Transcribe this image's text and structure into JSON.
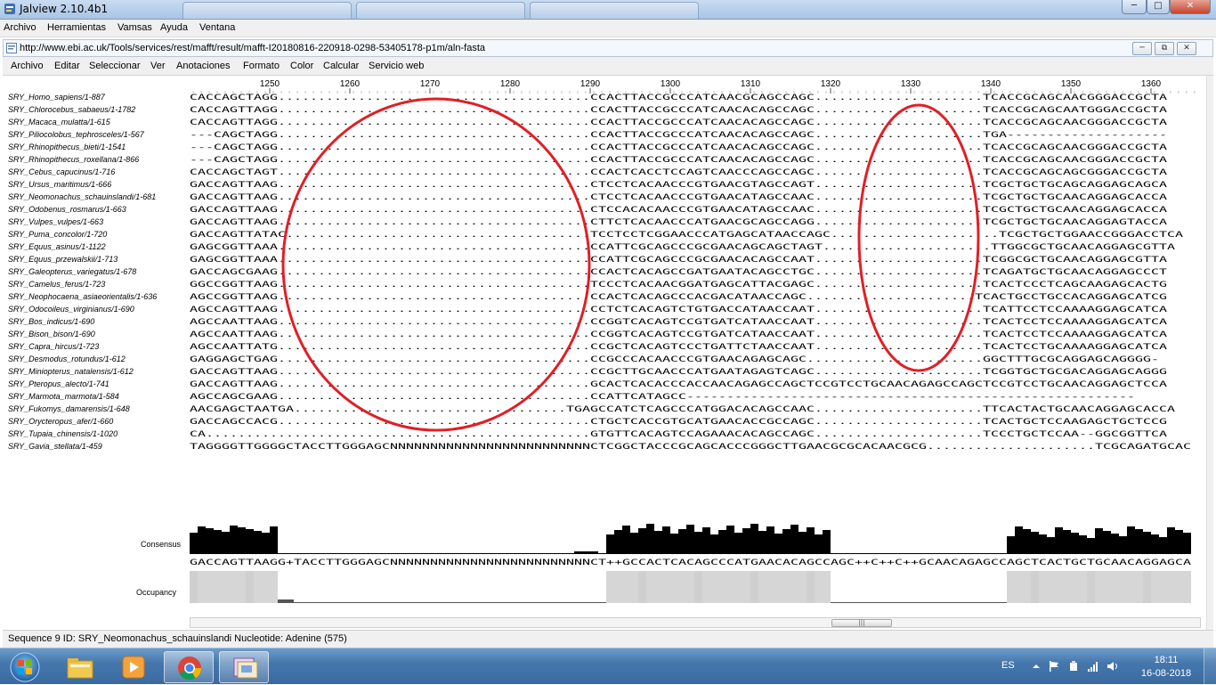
{
  "outer_window": {
    "title": "Jalview 2.10.4b1",
    "controls": {
      "minimize": "─",
      "maximize": "□",
      "close": "✕"
    }
  },
  "main_menu": [
    "Archivo",
    "Herramientas",
    "Vamsas",
    "Ayuda",
    "Ventana"
  ],
  "inner_window": {
    "title": "http://www.ebi.ac.uk/Tools/services/rest/mafft/result/mafft-I20180816-220918-0298-53405178-p1m/aln-fasta",
    "controls": {
      "minimize": "─",
      "maximize": "⧉",
      "close": "✕"
    }
  },
  "inner_menu": [
    "Archivo",
    "Editar",
    "Seleccionar",
    "Ver",
    "Anotaciones",
    "Formato",
    "Color",
    "Calcular",
    "Servicio web"
  ],
  "ruler_ticks": [
    "1250",
    "1260",
    "1270",
    "1280",
    "1290",
    "1300",
    "1310",
    "1320",
    "1330",
    "1340",
    "1350",
    "1360"
  ],
  "sequences": [
    {
      "name": "SRY_Homo_sapiens/1-887",
      "seq": "CACCAGCTAGG.......................................CCACTTACCGCCCATCAACGCAGCCAGC.....................TCACCGCAGCAACGGGACCGCTA"
    },
    {
      "name": "SRY_Chlorocebus_sabaeus/1-1782",
      "seq": "CACCAGTTAGG.......................................CCACTTACCGCCCATCAACACAGCCAGC.....................TCACCGCAGCAATGGGACCGCTA"
    },
    {
      "name": "SRY_Macaca_mulatta/1-615",
      "seq": "CACCAGTTAGG.......................................CCACTTACCGCCCATCAACACAGCCAGC.....................TCACCGCAGCAACGGGACCGCTA"
    },
    {
      "name": "SRY_Piliocolobus_tephrosceles/1-567",
      "seq": "---CAGCTAGG.......................................CCACTTACCGCCCATCAACACAGCCAGC.....................TGA--------------------"
    },
    {
      "name": "SRY_Rhinopithecus_bieti/1-1541",
      "seq": "---CAGCTAGG.......................................CCACTTACCGCCCATCAACACAGCCAGC.....................TCACCGCAGCAACGGGACCGCTA"
    },
    {
      "name": "SRY_Rhinopithecus_roxellana/1-866",
      "seq": "---CAGCTAGG.......................................CCACTTACCGCCCATCAACACAGCCAGC.....................TCACCGCAGCAACGGGACCGCTA"
    },
    {
      "name": "SRY_Cebus_capucinus/1-716",
      "seq": "CACCAGCTAGT.......................................CCACTCACCTCCAGTCAACCCAGCCAGC.....................TCACCGCAGCAGCGGGACCGCTA"
    },
    {
      "name": "SRY_Ursus_maritimus/1-666",
      "seq": "GACCAGTTAAG.......................................CTCCTCACAACCCGTGAACGTAGCCAGT.....................TCGCTGCTGCAGCAGGAGCAGCA"
    },
    {
      "name": "SRY_Neomonachus_schauinslandi/1-681",
      "seq": "GACCAGTTAAG.......................................CTCCTCACAACCCGTGAACATAGCCAAC.....................TCGCTGCTGCAACAGGAGCACCA"
    },
    {
      "name": "SRY_Odobenus_rosmarus/1-663",
      "seq": "GACCAGTTAAG.......................................CTCCACACAACCCGTGAACATAGCCAAC.....................TCGCTGCTGCAACAGGAGCACCA"
    },
    {
      "name": "SRY_Vulpes_vulpes/1-663",
      "seq": "GACCAGTTAAG.......................................CTTCTCACAACCCATGAACGCAGCCAGG.....................TCGCTGCTGCAACAGGAGTACCA"
    },
    {
      "name": "SRY_Puma_concolor/1-720",
      "seq": "GACCAGTTATAC......................................TCCTCCTCGGAACCCATGAGCATAACCAGC.....................TCGCTGCTGGAACCGGGACCTCA"
    },
    {
      "name": "SRY_Equus_asinus/1-1122",
      "seq": "GAGCGGTTAAA.......................................CCATTCGCAGCCCGCGAACAGCAGCTAGT.....................TTGGCGCTGCAACAGGAGCGTTA"
    },
    {
      "name": "SRY_Equus_przewalskii/1-713",
      "seq": "GAGCGGTTAAA.......................................CCATTCGCAGCCCGCGAACACAGCCAAT.....................TCGGCGCTGCAACAGGAGCGTTA"
    },
    {
      "name": "SRY_Galeopterus_variegatus/1-678",
      "seq": "GACCAGCGAAG.......................................CCACTCACAGCCGATGAATACAGCCTGC.....................TCAGATGCTGCAACAGGAGCCCT"
    },
    {
      "name": "SRY_Camelus_ferus/1-723",
      "seq": "GGCCGGTTAAG.......................................TCCCTCACAACGGATGAGCATTACGAGC.....................TCACTCCCTCAGCAAGAGCACTG"
    },
    {
      "name": "SRY_Neophocaena_asiaeorientalis/1-636",
      "seq": "AGCCGGTTAAG.......................................CCACTCACAGCCCACGACATAACCAGC.....................TCACTGCCTGCCACAGGAGCATCG"
    },
    {
      "name": "SRY_Odocoileus_virginianus/1-690",
      "seq": "AGCCAGTTAAG.......................................CCTCTCACAGTCTGTGACCATAACCAAT.....................TCATTCCTCCAAAAGGAGCATCA"
    },
    {
      "name": "SRY_Bos_indicus/1-690",
      "seq": "AGCCAATTAAG.......................................CCGGTCACAGTCCGTGATCATAACCAAT.....................TCACTCCTCCAAAAGGAGCATCA"
    },
    {
      "name": "SRY_Bison_bison/1-690",
      "seq": "AGCCAATTAAG.......................................CCGGTCACAGTCCGTGATCATAACCAAT.....................TCACTCCTCCAAAAGGAGCATCA"
    },
    {
      "name": "SRY_Capra_hircus/1-723",
      "seq": "AGCCAATTATG.......................................CCGCTCACAGTCCCTGATTCTAACCAAT.....................TCACTCCTGCAAAAGGAGCATCA"
    },
    {
      "name": "SRY_Desmodus_rotundus/1-612",
      "seq": "GAGGAGCTGAG.......................................CCGCCCACAACCCGTGAACAGAGCAGC......................GGCTTTGCGCAGGAGCAGGGG-"
    },
    {
      "name": "SRY_Miniopterus_natalensis/1-612",
      "seq": "GACCAGTTAAG.......................................CCGCTTGCAACCCATGAATAGAGTCAGC.....................TCGGTGCTGCGACAGGAGCAGGG"
    },
    {
      "name": "SRY_Pteropus_alecto/1-741",
      "seq": "GACCAGTTAAG.......................................GCACTCACACCCACCAACAGAGCCAGCTCCGTCCTGCAACAGAGCCAGCTCCGTCCTGCAACAGGAGCTCCA"
    },
    {
      "name": "SRY_Marmota_marmota/1-584",
      "seq": "AGCCAGCGAAG.......................................CCATTCATAGCC--------------------------------------------------------"
    },
    {
      "name": "SRY_Fukomys_damarensis/1-648",
      "seq": "AACGAGCTAATGA..................................TGAGCCATCTCAGCCCATGGACACAGCCAAC.....................TTCACTACTGCAACAGGAGCACCA"
    },
    {
      "name": "SRY_Orycteropus_afer/1-660",
      "seq": "GACCAGCCACG.......................................CTGCTCACCGTGCATGAACACCGCCAGC.....................TCACTGCTCCAAGAGCTGCTCCG"
    },
    {
      "name": "SRY_Tupaia_chinensis/1-1020",
      "seq": "CA................................................GTGTTCACAGTCCAGAAACACAGCCAGC.....................TCCCTGCTCCAA--GGCGGTTCA"
    },
    {
      "name": "SRY_Gavia_stellata/1-459",
      "seq": "TAGGGGTTGGGGCTACCTTGGGAGCNNNNNNNNNNNNNNNNNNNNNNNNNCTCGGCTACCCGCAGCACCCGGGCTTGAACGCGCACAACGCG.....................TCGCAGATGCACCCATGCACCG"
    }
  ],
  "annotations": {
    "consensus_label": "Consensus",
    "occupancy_label": "Occupancy",
    "consensus_seq": "GACCAGTTAAGG+TACCTTGGGAGCNNNNNNNNNNNNNNNNNNNNNNNNNCT++GCCACTCACAGCCCATGAACACAGCCAGC++C++C++GCAACAGAGCCAGCTCACTGCTGCAACAGGAGCACCA"
  },
  "status_bar": "Sequence 9 ID: SRY_Neomonachus_schauinslandi Nucleotide: Adenine (575)",
  "colors": {
    "highlight_circle": "#e01f26",
    "taskbar": "#4577ad"
  },
  "taskbar": {
    "items": [
      {
        "icon": "windows-start-icon"
      },
      {
        "icon": "file-explorer-icon"
      },
      {
        "icon": "media-player-icon"
      },
      {
        "icon": "chrome-icon"
      },
      {
        "icon": "jalview-icon"
      }
    ],
    "tray": {
      "language": "ES",
      "time": "18:11",
      "date": "16-08-2018"
    }
  }
}
